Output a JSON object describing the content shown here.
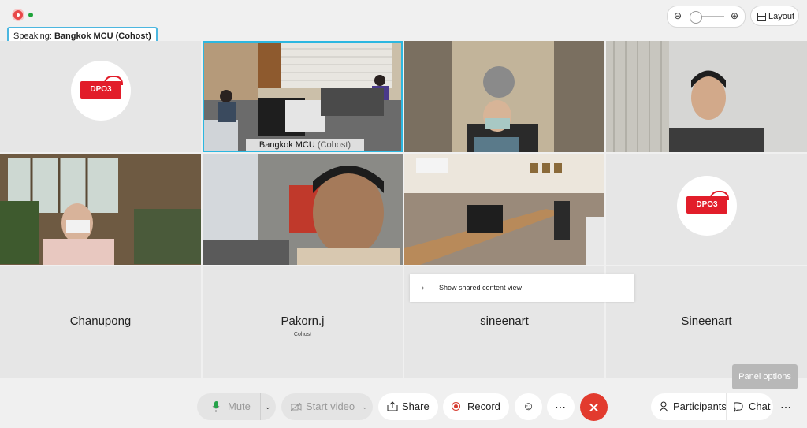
{
  "top": {
    "speaking_prefix": "Speaking:",
    "speaking_name": "Bangkok MCU (Cohost)",
    "zoom_out_icon": "zoom-out-icon",
    "zoom_in_icon": "zoom-in-icon",
    "zoom_level": 0.1,
    "layout_label": "Layout"
  },
  "tiles": {
    "logo_text": "DPO3",
    "main_label_name": "Bangkok MCU",
    "main_label_role": "(Cohost)",
    "names": {
      "chanupong": "Chanupong",
      "pakorn": "Pakorn.j",
      "pakorn_role": "Cohost",
      "sineenart_lower": "sineenart",
      "sineenart_upper": "Sineenart"
    }
  },
  "shared_popup": {
    "label": "Show shared content view"
  },
  "toolbar": {
    "mute": "Mute",
    "start_video": "Start video",
    "share": "Share",
    "record": "Record",
    "more": "⋯",
    "participants": "Participants",
    "chat": "Chat",
    "panel_options": "Panel options"
  },
  "colors": {
    "accent": "#2cb7e0",
    "end_call": "#e23b2e",
    "logo_red": "#e21d2a"
  }
}
